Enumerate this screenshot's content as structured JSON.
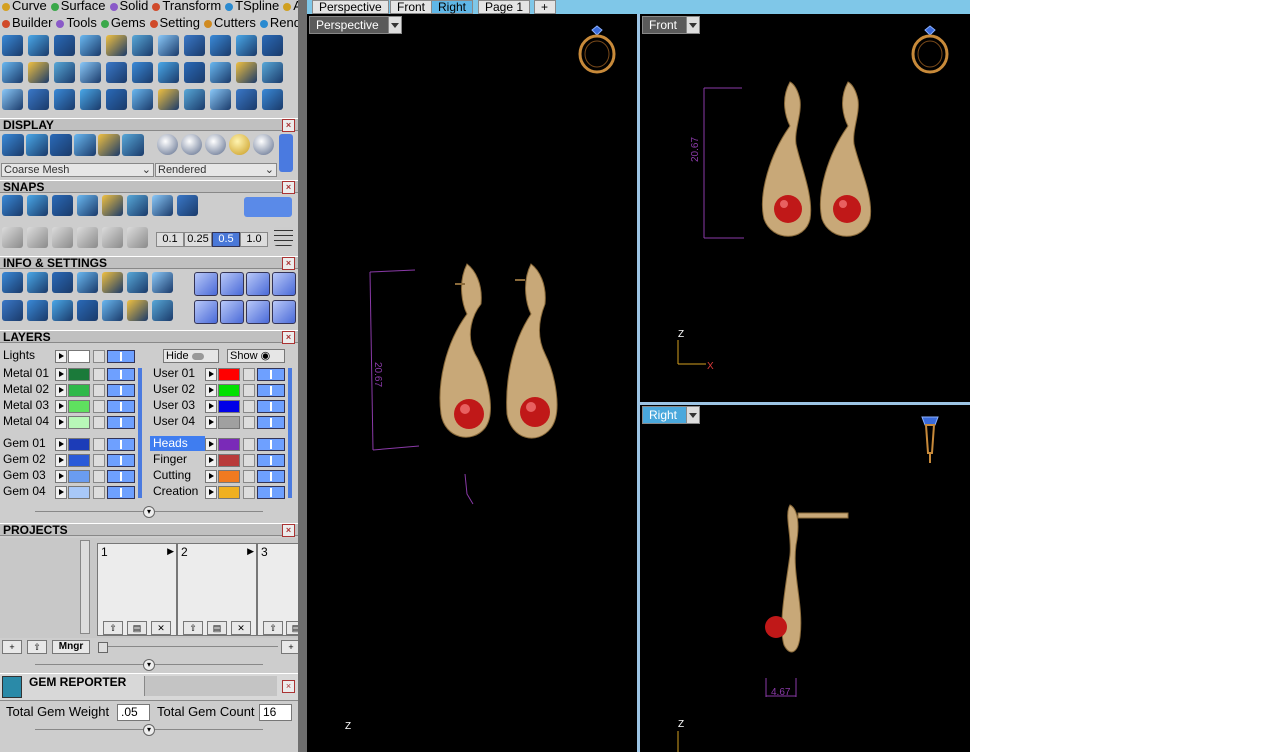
{
  "menu_row1": [
    {
      "label": "Curve",
      "color": "#d4a020"
    },
    {
      "label": "Surface",
      "color": "#3aa84a"
    },
    {
      "label": "Solid",
      "color": "#8a5ac8"
    },
    {
      "label": "Transform",
      "color": "#d04a2a"
    },
    {
      "label": "TSpline",
      "color": "#2a8ad0"
    },
    {
      "label": "Art",
      "color": "#d0a020"
    }
  ],
  "menu_row2": [
    {
      "label": "Builder",
      "color": "#d04a2a"
    },
    {
      "label": "Tools",
      "color": "#8a5ac8"
    },
    {
      "label": "Gems",
      "color": "#3aa84a"
    },
    {
      "label": "Setting",
      "color": "#d04a2a"
    },
    {
      "label": "Cutters",
      "color": "#d08a20"
    },
    {
      "label": "Render",
      "color": "#2a8ad0"
    }
  ],
  "display": {
    "header": "DISPLAY",
    "mesh_select": "Coarse Mesh",
    "render_select": "Rendered"
  },
  "snaps": {
    "header": "SNAPS",
    "values": [
      "0.1",
      "0.25",
      "0.5",
      "1.0"
    ]
  },
  "info": {
    "header": "INFO & SETTINGS"
  },
  "layers": {
    "header": "LAYERS",
    "lights_label": "Lights",
    "hide_label": "Hide",
    "show_label": "Show",
    "left": [
      {
        "name": "Metal 01",
        "color": "#1b7a3a"
      },
      {
        "name": "Metal 02",
        "color": "#2fb84a"
      },
      {
        "name": "Metal 03",
        "color": "#5fe05f"
      },
      {
        "name": "Metal 04",
        "color": "#b8f8b8"
      },
      {
        "name": "Gem 01",
        "color": "#1c3cb8"
      },
      {
        "name": "Gem 02",
        "color": "#2a5ad8"
      },
      {
        "name": "Gem 03",
        "color": "#6a9cf0"
      },
      {
        "name": "Gem 04",
        "color": "#a8c8f8"
      }
    ],
    "right": [
      {
        "name": "User 01",
        "color": "#ff0000"
      },
      {
        "name": "User 02",
        "color": "#00e000"
      },
      {
        "name": "User 03",
        "color": "#0000e8"
      },
      {
        "name": "User 04",
        "color": "#a0a0a0"
      },
      {
        "name": "Heads",
        "color": "#7a2ab8"
      },
      {
        "name": "Finger",
        "color": "#b83a3a"
      },
      {
        "name": "Cutting",
        "color": "#f07a20"
      },
      {
        "name": "Creation",
        "color": "#f0b020"
      }
    ]
  },
  "projects": {
    "header": "PROJECTS",
    "slots": [
      "1",
      "2",
      "3"
    ],
    "mngr_label": "Mngr"
  },
  "gem_reporter": {
    "header": "GEM REPORTER",
    "weight_label": "Total Gem Weight",
    "weight_value": ".05",
    "count_label": "Total Gem Count",
    "count_value": "16"
  },
  "tabs": [
    "Perspective",
    "Front",
    "Right",
    "Page 1",
    "+"
  ],
  "active_tab": "Right",
  "viewports": {
    "perspective": {
      "label": "Perspective",
      "dim": "20.67"
    },
    "front": {
      "label": "Front",
      "dim": "20.67",
      "axis_z": "Z",
      "axis_x": "X"
    },
    "right": {
      "label": "Right",
      "dim": "4.67",
      "axis_z": "Z"
    },
    "bottom_axis_z": "Z"
  },
  "colors": {
    "gold": "#c8a878",
    "ruby": "#c01818",
    "dimension": "#8a3aa8",
    "viewport_bg": "#000000",
    "panel_bg": "#cdcdcd"
  }
}
